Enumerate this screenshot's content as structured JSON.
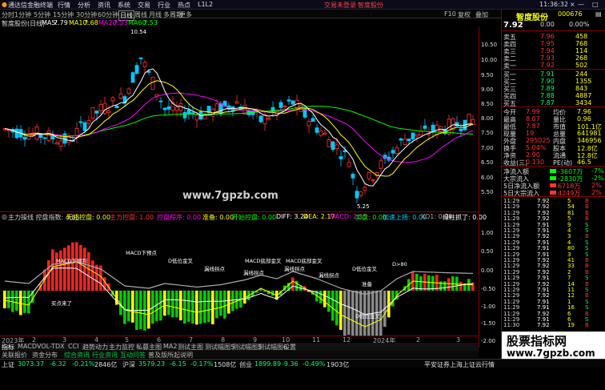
{
  "titlebar": {
    "app_name": "通达信金融终端",
    "menus": [
      "行情",
      "分析",
      "资讯",
      "系统",
      "交易",
      "行业",
      "热点",
      "L1L2"
    ],
    "tabs": [
      "交易未登录",
      "智度股份"
    ],
    "time": "11:36:32",
    "window_buttons": [
      "功能",
      "帮助",
      "×"
    ]
  },
  "toolbar": {
    "periods": [
      "分时",
      "1分钟",
      "5分钟",
      "15分钟",
      "30分钟",
      "60分钟",
      "日线",
      "周线",
      "月线",
      "多周期",
      "更多"
    ],
    "active_period": "日线",
    "right_items": [
      "F10",
      "复权",
      "叠加"
    ]
  },
  "infobar": {
    "title": "智度股份(日线)",
    "ma5_label": "MA5:",
    "ma5_value": "7.79",
    "ma10_label": "MA10:",
    "ma10_value": "7.68",
    "ma20_label": "MA20:",
    "ma20_value": "7.53",
    "ma60_label": "MA60:",
    "ma60_value": "7.53"
  },
  "kline": {
    "high_label": "10.54",
    "low_label": "5.25",
    "watermark": "www.7gpzb.com",
    "colors": {
      "up": "#ff3333",
      "down": "#00c8ff",
      "ma5": "#ffffff",
      "ma10": "#ffff00",
      "ma20": "#ff00ff",
      "ma60": "#00ff00"
    }
  },
  "yaxis": {
    "labels": [
      "10.50",
      "10.00",
      "9.50",
      "9.00",
      "8.50",
      "8.00",
      "7.50",
      "7.00",
      "6.50",
      "6.00",
      "5.50",
      "1.00",
      "0.50",
      "0.00",
      "-0.50",
      "-1.00",
      "-1.50",
      "-2.00"
    ]
  },
  "indicator_bar": {
    "name": "主力搞线",
    "items": [
      {
        "text": "主力操线 控盘指数: 4.85",
        "color": "#cccccc"
      },
      {
        "text": "无庄控盘: 0.00",
        "color": "#ffff00"
      },
      {
        "text": "主力控盘: 1.00",
        "color": "#ff3333"
      },
      {
        "text": "控盘程序: 0.00",
        "color": "#ff00ff"
      },
      {
        "text": "准备: 0.00",
        "color": "#ffff00"
      },
      {
        "text": "开始控盘: 0.00",
        "color": "#00ff00"
      },
      {
        "text": "DIFF: 3.24",
        "color": "#ffffff"
      },
      {
        "text": "DEA: 2.17",
        "color": "#ffff00"
      },
      {
        "text": "MACD: 2.15",
        "color": "#ff00ff"
      },
      {
        "text": "卖盘: 0.00",
        "color": "#00ff00"
      },
      {
        "text": "加速上扬: 0.00",
        "color": "#00ccff"
      },
      {
        "text": "XO1: 0.00",
        "color": "#aaaaaa"
      },
      {
        "text": "绿柱抓了: 0.00",
        "color": "#ffffff"
      }
    ]
  },
  "signals": {
    "macd_cross": "MACD下预判",
    "buy_point": "买点来了",
    "macd_cross_point": "MACD下预点",
    "dk_gold": "D低位金叉",
    "turn_point1": "漏线拐点",
    "turn_point2": "漏线拐点",
    "turn_point3": "漏线拐点",
    "macd_gold": "MACD底部金叉",
    "macd_gold2": "MACD底部金叉",
    "dk_gold2": "D低位金叉",
    "d_80": "D>80",
    "prepare": "准备",
    "kd_gold": "D低位金叉",
    "turn_point4": "漏线拐点"
  },
  "date_axis": {
    "labels": [
      "2023年",
      "2",
      "3",
      "4",
      "5",
      "6",
      "7",
      "8",
      "9",
      "10",
      "11",
      "12",
      "2024年",
      "2",
      "3"
    ]
  },
  "tabrow": {
    "tabs": [
      "指标",
      "MACD",
      "VOL-TDX",
      "CCI",
      "趋势动力",
      "主力监控",
      "私募主图",
      "MA2",
      "测试主图",
      "测试幅图5",
      "测试幅图5",
      "测试幅图6",
      "设置"
    ]
  },
  "infotabs": {
    "tabs": [
      "关联报价",
      "资金分布",
      "综合资讯",
      "行业资讯",
      "互动问答",
      "普及版所起说明"
    ]
  },
  "statusbar": {
    "items": [
      {
        "label": "上证",
        "value": "3073.37",
        "chg": "-6.32",
        "pct": "-0.21%",
        "vol": "2846亿"
      },
      {
        "label": "沪深",
        "value": "3579.23",
        "chg": "-6.15",
        "pct": "-0.17%",
        "vol": "1508亿"
      },
      {
        "label": "创业",
        "value": "1899.89",
        "chg": "-9.36",
        "pct": "-0.49%",
        "vol": "1903亿"
      }
    ],
    "right_text": "平安证券上海上证云行情"
  },
  "panel": {
    "name": "智度股份",
    "code": "000676",
    "price": "7.92",
    "change": "0.00",
    "pct": "0.00%",
    "order_book": {
      "asks": [
        {
          "label": "卖五",
          "price": "7.96",
          "vol": "458"
        },
        {
          "label": "卖四",
          "price": "7.95",
          "vol": "768"
        },
        {
          "label": "卖三",
          "price": "7.94",
          "vol": "114"
        },
        {
          "label": "卖二",
          "price": "7.93",
          "vol": "268"
        },
        {
          "label": "卖一",
          "price": "7.92",
          "vol": "502"
        }
      ],
      "bids": [
        {
          "label": "买一",
          "price": "7.91",
          "vol": "244"
        },
        {
          "label": "买二",
          "price": "7.90",
          "vol": "1355"
        },
        {
          "label": "买三",
          "price": "7.89",
          "vol": "843"
        },
        {
          "label": "买四",
          "price": "7.88",
          "vol": "4887"
        },
        {
          "label": "买五",
          "price": "7.87",
          "vol": "3434"
        }
      ]
    },
    "stats": [
      {
        "l1": "今开",
        "v1": "7.99",
        "l2": "均价",
        "v2": "7.96"
      },
      {
        "l1": "最高",
        "v1": "8.07",
        "l2": "量比",
        "v2": "0.96"
      },
      {
        "l1": "最低",
        "v1": "7.87",
        "l2": "市值",
        "v2": "101.1亿"
      },
      {
        "l1": "现量",
        "v1": "19",
        "l2": "总量",
        "v2": "641981"
      },
      {
        "l1": "外盘",
        "v1": "295025",
        "l2": "内盘",
        "v2": "346956"
      },
      {
        "l1": "换手",
        "v1": "5.04%",
        "l2": "股本",
        "v2": "12.8亿"
      },
      {
        "l1": "净资",
        "v1": "2.90",
        "l2": "流通",
        "v2": "12.8亿"
      },
      {
        "l1": "收益(三)",
        "v1": "0.130",
        "l2": "PE(动)",
        "v2": "46.5"
      }
    ],
    "flows": [
      {
        "label": "净流入额",
        "value": "-3607万",
        "pct": "-7%",
        "color": "#00ff00"
      },
      {
        "label": "大宗流入",
        "value": "-2830万",
        "pct": "-2%",
        "color": "#00ff00"
      },
      {
        "label": "5日净流入额",
        "value": "6718万",
        "pct": "2%",
        "color": "#ff3333"
      },
      {
        "label": "5日大宗流入",
        "value": "4249万",
        "pct": "2%",
        "color": "#ff3333"
      }
    ],
    "ticks": [
      {
        "time": "11:29",
        "price": "7.92",
        "vol": "5",
        "side": "B"
      },
      {
        "time": "11:29",
        "price": "7.92",
        "vol": "54",
        "side": "B"
      },
      {
        "time": "11:29",
        "price": "7.92",
        "vol": "81",
        "side": "B"
      },
      {
        "time": "11:29",
        "price": "7.92",
        "vol": "5",
        "side": "B"
      },
      {
        "time": "11:29",
        "price": "7.91",
        "vol": "9",
        "side": "S"
      },
      {
        "time": "11:29",
        "price": "7.91",
        "vol": "4",
        "side": "S"
      },
      {
        "time": "11:29",
        "price": "7.92",
        "vol": "3",
        "side": "B"
      },
      {
        "time": "11:29",
        "price": "7.91",
        "vol": "4",
        "side": "S"
      },
      {
        "time": "11:29",
        "price": "7.91",
        "vol": "80",
        "side": "S"
      },
      {
        "time": "11:29",
        "price": "7.91",
        "vol": "3",
        "side": "S"
      },
      {
        "time": "11:29",
        "price": "7.92",
        "vol": "41",
        "side": "B"
      },
      {
        "time": "11:29",
        "price": "7.92",
        "vol": "33",
        "side": "B"
      },
      {
        "time": "11:29",
        "price": "7.92",
        "vol": "2",
        "side": "B"
      },
      {
        "time": "11:29",
        "price": "7.91",
        "vol": "7",
        "side": "S"
      },
      {
        "time": "11:29",
        "price": "7.92",
        "vol": "14",
        "side": "B"
      },
      {
        "time": "11:29",
        "price": "7.91",
        "vol": "11",
        "side": "S"
      },
      {
        "time": "11:29",
        "price": "7.92",
        "vol": "12",
        "side": "B"
      },
      {
        "time": "11:29",
        "price": "7.91",
        "vol": "1",
        "side": "S"
      },
      {
        "time": "11:29",
        "price": "7.91",
        "vol": "16",
        "side": "S"
      },
      {
        "time": "11:29",
        "price": "7.92",
        "vol": "6",
        "side": "B"
      },
      {
        "time": "11:29",
        "price": "7.91",
        "vol": "6",
        "side": "S"
      },
      {
        "time": "11:30",
        "price": "7.92",
        "vol": "19",
        "side": "B"
      }
    ]
  },
  "bottom_right": {
    "watermark_line1": "股票指标网",
    "watermark_line2": "www.7gpzb.com",
    "tabs": [
      "图文F10",
      "财经"
    ]
  }
}
